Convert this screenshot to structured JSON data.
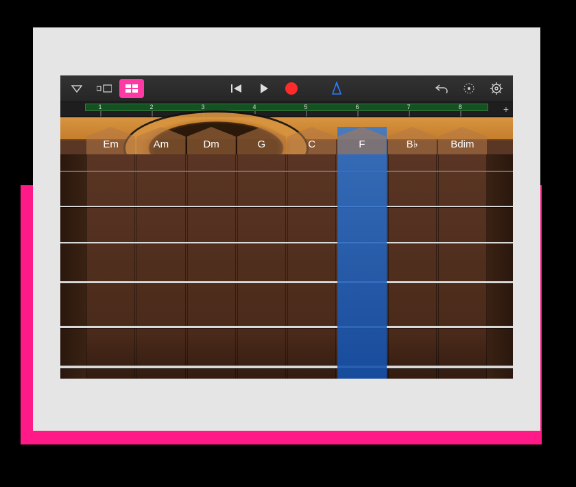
{
  "toolbar": {
    "browser_label": "browser",
    "tracks_label": "tracks",
    "chordview_label": "chord-view",
    "rewind_label": "rewind",
    "play_label": "play",
    "record_label": "record",
    "metronome_label": "metronome",
    "undo_label": "undo",
    "tuning_label": "tuning",
    "settings_label": "settings"
  },
  "ruler": {
    "bars": [
      "1",
      "2",
      "3",
      "4",
      "5",
      "6",
      "7",
      "8"
    ],
    "add_label": "+"
  },
  "chords": [
    "Em",
    "Am",
    "Dm",
    "G",
    "C",
    "F",
    "B♭",
    "Bdim"
  ],
  "highlighted_chord_index": 5,
  "colors": {
    "accent_pink": "#ff3aa4",
    "record_red": "#ff2a2a",
    "metronome_blue": "#2b7dff",
    "highlight_blue": "#1e5ab4"
  }
}
